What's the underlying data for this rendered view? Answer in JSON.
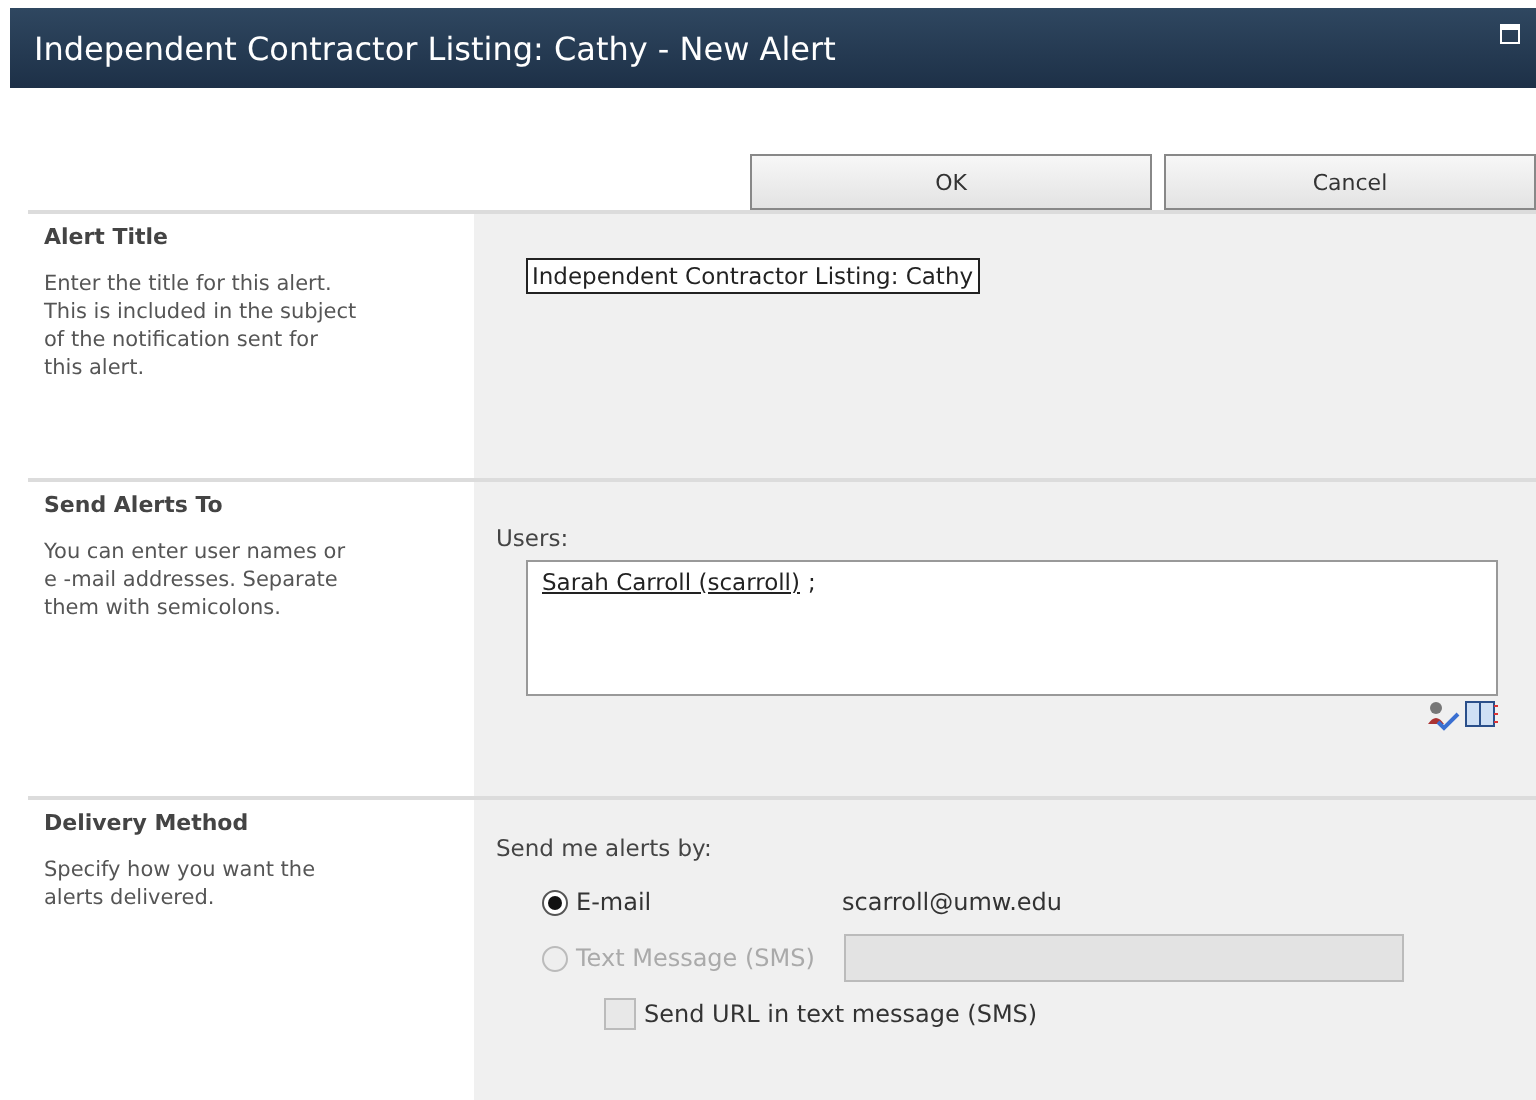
{
  "window": {
    "title": "Independent Contractor Listing: Cathy - New Alert"
  },
  "buttons": [
    {
      "label": "OK"
    },
    {
      "label": "Cancel"
    }
  ],
  "sections": [
    {
      "kind": "title",
      "heading": "Alert Title",
      "description": "Enter the title for this alert. This is included in the subject of the notification sent for this alert.",
      "value": "Independent Contractor Listing: Cathy"
    },
    {
      "kind": "users",
      "heading": "Send Alerts To",
      "description": "You can enter user names or e -mail addresses. Separate them with semicolons.",
      "label": "Users:",
      "user": "Sarah Carroll (scarroll)",
      "separator": ";"
    },
    {
      "kind": "delivery",
      "heading": "Delivery Method",
      "description": "Specify how you want the alerts delivered.",
      "label": "Send me alerts by:",
      "options": [
        {
          "label": "E-mail",
          "selected": true,
          "disabled": false,
          "detail": "scarroll@umw.edu"
        },
        {
          "label": "Text Message (SMS)",
          "selected": false,
          "disabled": true
        }
      ],
      "sms_url": {
        "label": "Send URL in text message (SMS)",
        "checked": false,
        "disabled": true
      }
    }
  ]
}
